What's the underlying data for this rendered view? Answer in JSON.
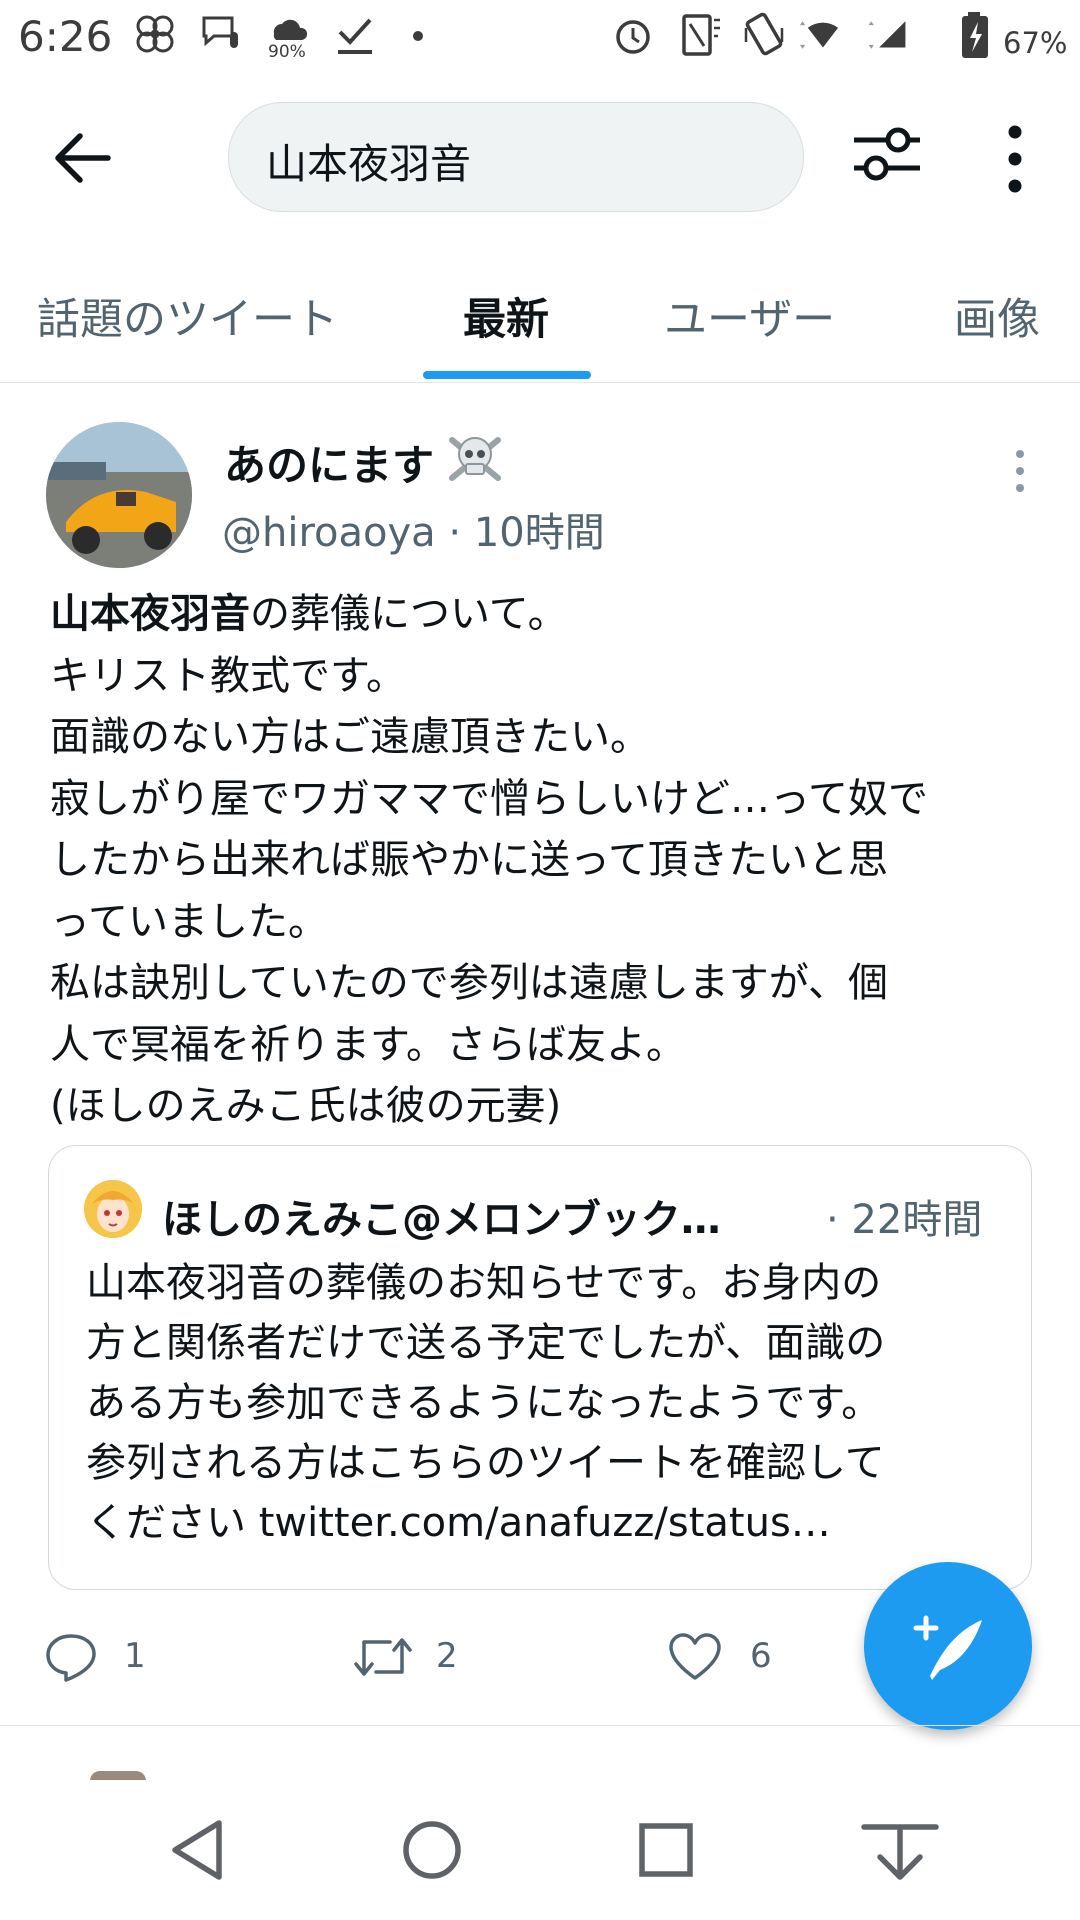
{
  "status_bar": {
    "time": "6:26",
    "weather_percent": "90%",
    "battery": "67%"
  },
  "search": {
    "query": "山本夜羽音"
  },
  "tabs": [
    {
      "label": "話題のツイート",
      "active": false
    },
    {
      "label": "最新",
      "active": true
    },
    {
      "label": "ユーザー",
      "active": false
    },
    {
      "label": "画像",
      "active": false
    }
  ],
  "tweet": {
    "display_name": "あのにます",
    "handle_time": "@hiroaoya · 10時間",
    "body_bold": "山本夜羽音",
    "body_rest": "の葬儀について。\nキリスト教式です。\n面識のない方はご遠慮頂きたい。\n寂しがり屋でワガママで憎らしいけど…って奴で\nしたから出来れば賑やかに送って頂きたいと思\nっていました。\n私は訣別していたので参列は遠慮しますが、個\n人で冥福を祈ります。さらば友よ。\n(ほしのえみこ氏は彼の元妻)",
    "quote": {
      "name": "ほしのえみこ@メロンブック…",
      "time": "· 22時間",
      "body": "山本夜羽音の葬儀のお知らせです。お身内の\n方と関係者だけで送る予定でしたが、面識の\nある方も参加できるようになったようです。\n参列される方はこちらのツイートを確認して\nください twitter.com/anafuzz/status…"
    },
    "actions": {
      "replies": "1",
      "retweets": "2",
      "likes": "6"
    }
  },
  "colors": {
    "accent": "#1d9bf0",
    "text_primary": "#0f1419",
    "text_secondary": "#536471",
    "search_bg": "#eff3f4"
  },
  "icons": {
    "back": "arrow-left-icon",
    "filter": "sliders-icon",
    "more": "more-vertical-icon",
    "reply": "speech-bubble-icon",
    "retweet": "retweet-icon",
    "like": "heart-icon",
    "compose": "feather-plus-icon"
  }
}
